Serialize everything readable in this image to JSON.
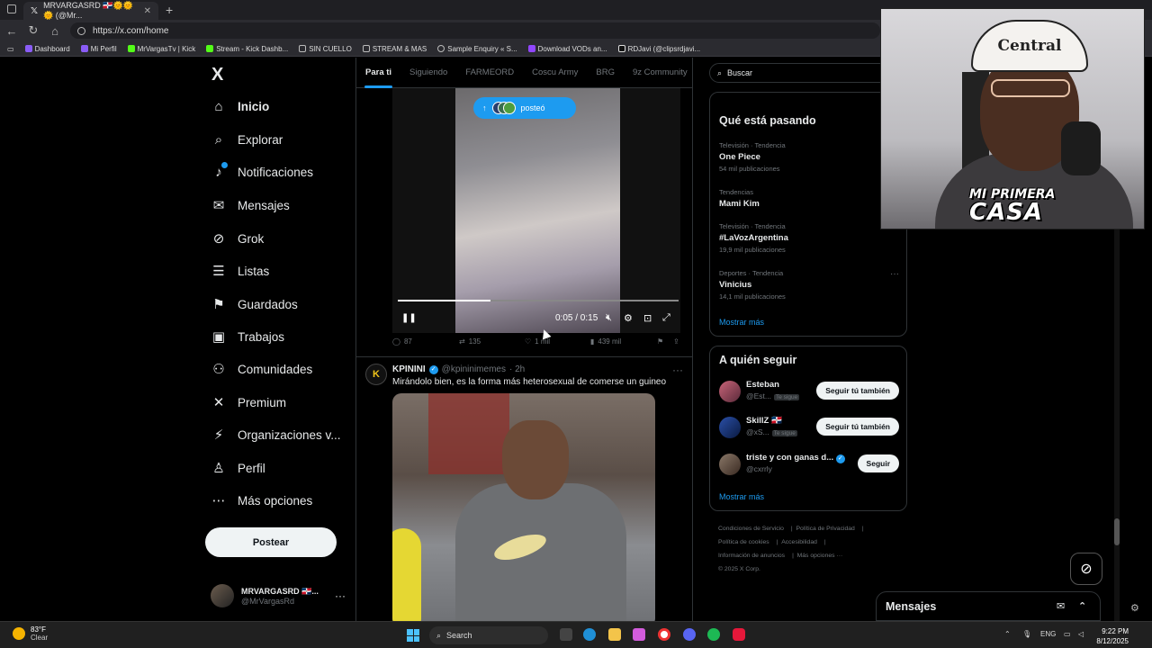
{
  "browser": {
    "tab_title": "MRVARGASRD 🇩🇴🌞🌞🌞 (@Mr...",
    "url": "https://x.com/home",
    "bookmarks": [
      "Dashboard",
      "Mi Perfil",
      "MrVargasTv | Kick",
      "Stream - Kick Dashb...",
      "SIN CUELLO",
      "STREAM & MAS",
      "Sample Enquiry « S...",
      "Download VODs an...",
      "RDJavi (@clipsrdjavi..."
    ]
  },
  "sidebar": {
    "logo": "X",
    "items": [
      {
        "label": "Inicio",
        "icon": "home-icon"
      },
      {
        "label": "Explorar",
        "icon": "search-icon"
      },
      {
        "label": "Notificaciones",
        "icon": "bell-icon"
      },
      {
        "label": "Mensajes",
        "icon": "mail-icon"
      },
      {
        "label": "Grok",
        "icon": "grok-icon"
      },
      {
        "label": "Listas",
        "icon": "list-icon"
      },
      {
        "label": "Guardados",
        "icon": "bookmark-icon"
      },
      {
        "label": "Trabajos",
        "icon": "briefcase-icon"
      },
      {
        "label": "Comunidades",
        "icon": "people-icon"
      },
      {
        "label": "Premium",
        "icon": "x-icon"
      },
      {
        "label": "Organizaciones v...",
        "icon": "bolt-icon"
      },
      {
        "label": "Perfil",
        "icon": "person-icon"
      },
      {
        "label": "Más opciones",
        "icon": "more-circle-icon"
      }
    ],
    "post_button": "Postear",
    "account": {
      "name": "MRVARGASRD 🇩🇴...",
      "handle": "@MrVargasRd"
    }
  },
  "feed": {
    "tabs": [
      "Para ti",
      "Siguiendo",
      "FARMEORD",
      "Coscu Army",
      "BRG",
      "9z Community"
    ],
    "posted_pill": "posteó",
    "video": {
      "time": "0:05 / 0:15",
      "progress": 0.33
    },
    "tweet1_actions": {
      "replies": "87",
      "reposts": "135",
      "likes": "1 mil",
      "views": "439 mil"
    },
    "tweet2": {
      "name": "KPININI",
      "handle": "@kpininimemes",
      "time": "· 2h",
      "text": "Mirándolo bien, es la forma más heterosexual de comerse un guineo"
    }
  },
  "right": {
    "search_placeholder": "Buscar",
    "trending_title": "Qué está pasando",
    "trends": [
      {
        "category": "Televisión · Tendencia",
        "title": "One Piece",
        "count": "54 mil publicaciones"
      },
      {
        "category": "Tendencias",
        "title": "Mami Kim",
        "count": ""
      },
      {
        "category": "Televisión · Tendencia",
        "title": "#LaVozArgentina",
        "count": "19,9 mil publicaciones"
      },
      {
        "category": "Deportes · Tendencia",
        "title": "Vinicius",
        "count": "14,1 mil publicaciones"
      }
    ],
    "show_more": "Mostrar más",
    "follow_title": "A quién seguir",
    "follow": [
      {
        "name": "Esteban",
        "handle": "@Est...",
        "badge": "Te sigue",
        "button": "Seguir tú también"
      },
      {
        "name": "SkillZ 🇩🇴",
        "handle": "@xS...",
        "badge": "Te sigue",
        "button": "Seguir tú también"
      },
      {
        "name": "triste y con ganas d...",
        "handle": "@cxrrly",
        "badge": "",
        "button": "Seguir"
      }
    ],
    "footer": [
      "Condiciones de Servicio",
      "Política de Privacidad",
      "Política de cookies",
      "Accesibilidad",
      "Información de anuncios",
      "Más opciones ···",
      "© 2025 X Corp."
    ]
  },
  "messages_dock": "Mensajes",
  "webcam": {
    "hat_text": "Central",
    "logo_line1": "MI PRIMERA",
    "logo_line2": "CASA"
  },
  "taskbar": {
    "temp": "83°F",
    "weather": "Clear",
    "search": "Search",
    "lang": "ENG",
    "time": "9:22 PM",
    "date": "8/12/2025"
  }
}
